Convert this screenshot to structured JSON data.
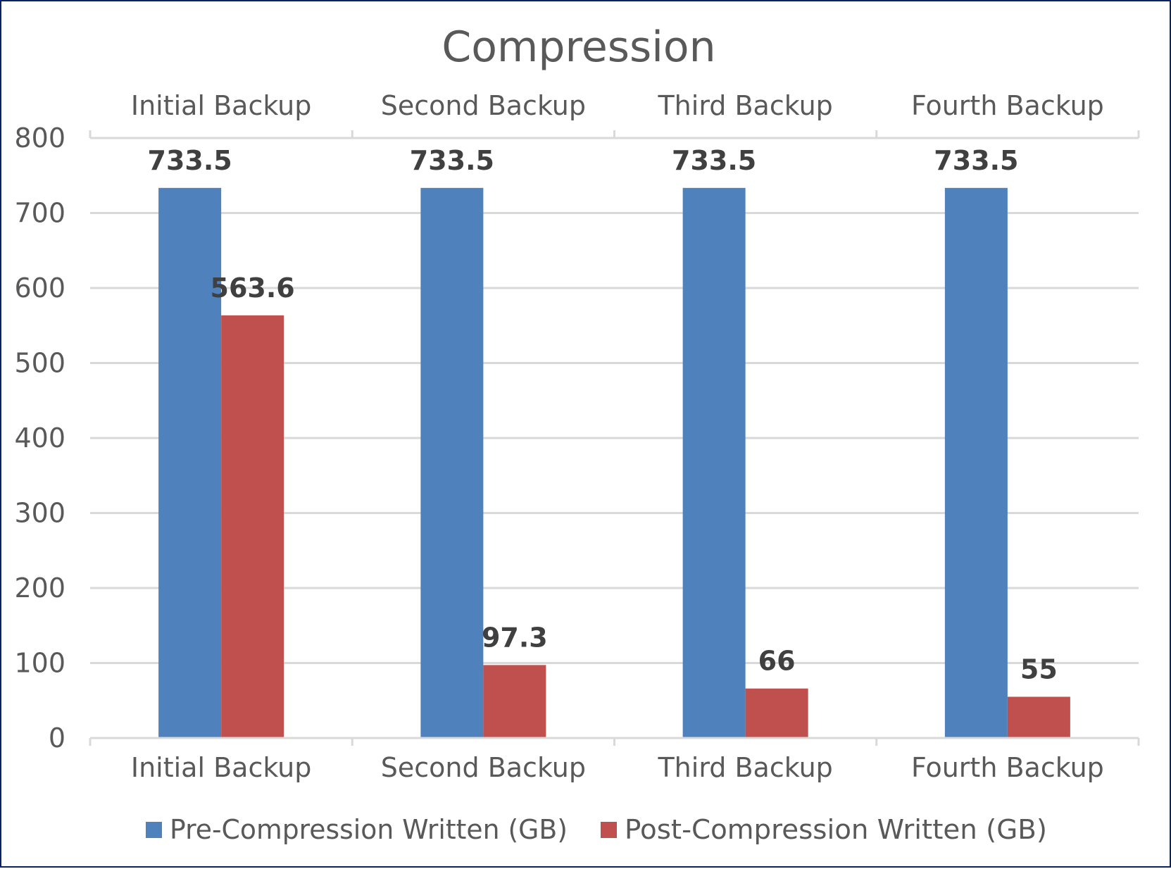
{
  "chart_data": {
    "type": "bar",
    "title": "Compression",
    "categories": [
      "Initial Backup",
      "Second Backup",
      "Third Backup",
      "Fourth Backup"
    ],
    "series": [
      {
        "name": "Pre-Compression Written (GB)",
        "color": "#4f81bd",
        "values": [
          733.5,
          733.5,
          733.5,
          733.5
        ]
      },
      {
        "name": "Post-Compression Written (GB)",
        "color": "#c0504d",
        "values": [
          563.6,
          97.3,
          66,
          55
        ]
      }
    ],
    "data_labels": [
      [
        "733.5",
        "733.5",
        "733.5",
        "733.5"
      ],
      [
        "563.6",
        "97.3",
        "66",
        "55"
      ]
    ],
    "xlabel": "",
    "ylabel": "",
    "ylim": [
      0,
      800
    ],
    "yticks": [
      0,
      100,
      200,
      300,
      400,
      500,
      600,
      700,
      800
    ],
    "category_labels_top": true,
    "category_labels_bottom": true,
    "grid": true,
    "legend": "bottom"
  },
  "colors": {
    "border": "#0a2463",
    "grid": "#d9d9d9",
    "text": "#595959",
    "label_text": "#404040"
  }
}
